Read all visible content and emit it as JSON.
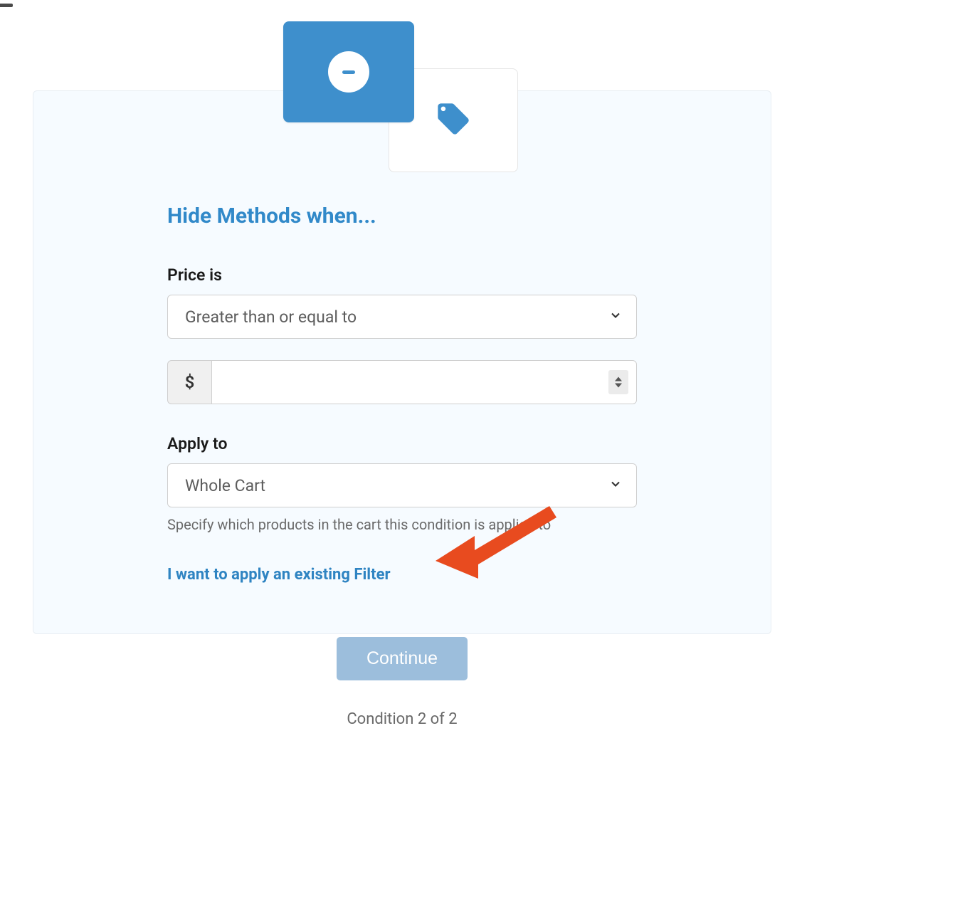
{
  "heading": "Hide Methods when...",
  "priceLabel": "Price is",
  "priceOperator": "Greater than or equal to",
  "currencySymbol": "$",
  "priceValue": "",
  "applyLabel": "Apply to",
  "applyValue": "Whole Cart",
  "applyHelp": "Specify which products in the cart this condition is applied to",
  "filterLink": "I want to apply an existing Filter",
  "continueLabel": "Continue",
  "conditionStatus": "Condition 2 of 2"
}
